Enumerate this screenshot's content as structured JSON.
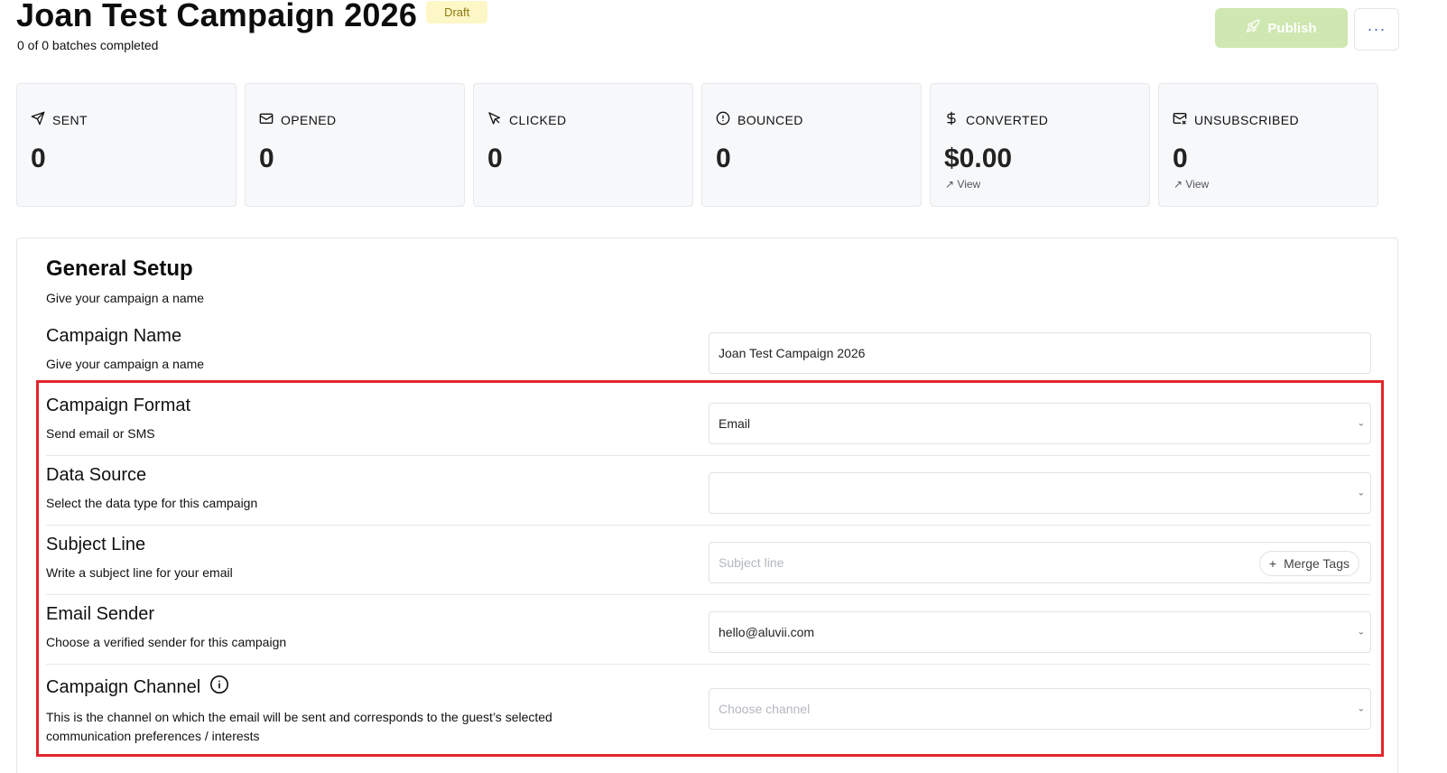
{
  "header": {
    "title": "Joan Test Campaign 2026",
    "status_badge": "Draft",
    "progress_text": "0 of  0 batches completed",
    "publish_label": "Publish",
    "more_label": "···"
  },
  "stats": [
    {
      "label": "SENT",
      "value": "0",
      "icon": "send-icon"
    },
    {
      "label": "OPENED",
      "value": "0",
      "icon": "mail-open-icon"
    },
    {
      "label": "CLICKED",
      "value": "0",
      "icon": "cursor-icon"
    },
    {
      "label": "BOUNCED",
      "value": "0",
      "icon": "alert-circle-icon"
    },
    {
      "label": "CONVERTED",
      "value": "$0.00",
      "icon": "dollar-icon",
      "link": "View"
    },
    {
      "label": "UNSUBSCRIBED",
      "value": "0",
      "icon": "mail-x-icon",
      "link": "View"
    }
  ],
  "link_arrow": "↗",
  "setup": {
    "title": "General Setup",
    "description": "Give your campaign a name",
    "campaign_name": {
      "label": "Campaign Name",
      "description": "Give your campaign a name",
      "value": "Joan Test Campaign 2026"
    },
    "campaign_format": {
      "label": "Campaign Format",
      "description": "Send email or SMS",
      "value": "Email"
    },
    "data_source": {
      "label": "Data Source",
      "description": "Select the data type for this campaign",
      "value": ""
    },
    "subject_line": {
      "label": "Subject Line",
      "description": "Write a subject line for your email",
      "placeholder": "Subject line",
      "merge_tags_label": "Merge Tags"
    },
    "email_sender": {
      "label": "Email Sender",
      "description": "Choose a verified sender for this campaign",
      "value": "hello@aluvii.com"
    },
    "campaign_channel": {
      "label": "Campaign Channel",
      "description_line1": "This is the channel on which the email will be sent and corresponds to the guest’s selected",
      "description_line2": "communication preferences / interests",
      "placeholder": "Choose channel"
    }
  },
  "colors": {
    "publish_bg": "#cfe7b0",
    "highlight": "#e2262b",
    "badge_bg": "#fdf6c6"
  }
}
